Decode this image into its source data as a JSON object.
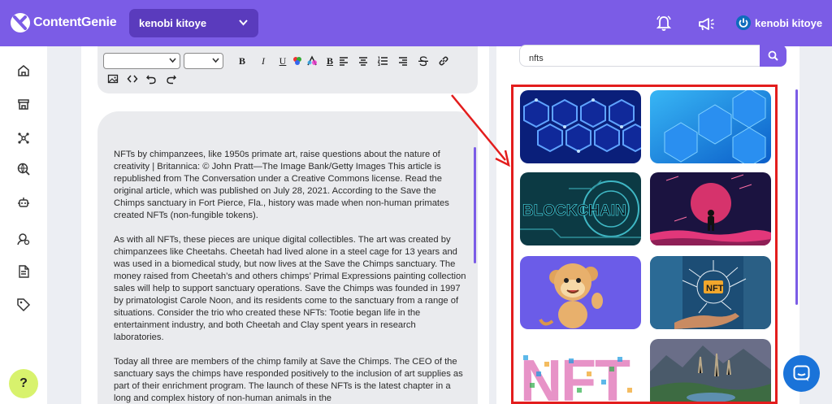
{
  "app": {
    "brand": "ContentGenie",
    "workspace": "kenobi kitoye",
    "user_name": "kenobi kitoye"
  },
  "colors": {
    "brand_purple": "#7b5ce6",
    "workspace_bg": "#5a3bbd",
    "highlight_red": "#e31d1d",
    "help_green": "#d8f26d",
    "chat_blue": "#1a73d9"
  },
  "header": {
    "icons": [
      "bell-icon",
      "megaphone-icon",
      "power-icon"
    ]
  },
  "sidebar": {
    "items": [
      "home-icon",
      "store-icon",
      "network-icon",
      "search-globe-icon",
      "robot-icon",
      "user-settings-icon",
      "document-icon",
      "tag-icon"
    ],
    "help_label": "?"
  },
  "toolbar": {
    "font_select": "",
    "size_select": "",
    "buttons": [
      "B",
      "I",
      "U",
      "text-color",
      "bg-color",
      "B",
      "align-left",
      "align-center",
      "ordered-list",
      "align-right",
      "strikethrough",
      "link",
      "image",
      "code",
      "undo",
      "redo"
    ]
  },
  "article": {
    "paragraphs": [
      "NFTs by chimpanzees, like 1950s primate art, raise questions about the nature of creativity | Britannica: © John Pratt—The Image Bank/Getty Images This article is republished from The Conversation under a Creative Commons license. Read the original article, which was published on July 28, 2021. According to the Save the Chimps sanctuary in Fort Pierce, Fla., history was made when non-human primates created NFTs (non-fungible tokens).",
      "As with all NFTs, these pieces are unique digital collectibles. The art was created by chimpanzees like Cheetahs. Cheetah had lived alone in a steel cage for 13 years and was used in a biomedical study, but now lives at the Save the Chimps sanctuary. The money raised from Cheetah’s and others chimps’ Primal Expressions painting collection sales will help to support sanctuary operations. Save the Chimps was founded in 1997 by primatologist Carole Noon, and its residents come to the sanctuary from a range of situations. Consider the trio who created these NFTs: Tootie began life in the entertainment industry, and both Cheetah and Clay spent years in research laboratories.",
      "Today all three are members of the chimp family at Save the Chimps. The CEO of the sanctuary says the chimps have responded positively to the inclusion of art supplies as part of their enrichment program. The launch of these NFTs is the latest chapter in a long and complex history of non-human animals in the"
    ]
  },
  "image_search": {
    "query": "nfts",
    "results": [
      {
        "name": "blue-hexagon-network"
      },
      {
        "name": "blue-hexagon-tiles"
      },
      {
        "name": "blockchain-circuit",
        "text": "BLOCKCHAIN"
      },
      {
        "name": "astronaut-planet"
      },
      {
        "name": "cartoon-monkey"
      },
      {
        "name": "hand-nft-circuit",
        "text": "NFT"
      },
      {
        "name": "nft-letters-collage",
        "text": "NFT"
      },
      {
        "name": "fantasy-landscape"
      }
    ]
  }
}
